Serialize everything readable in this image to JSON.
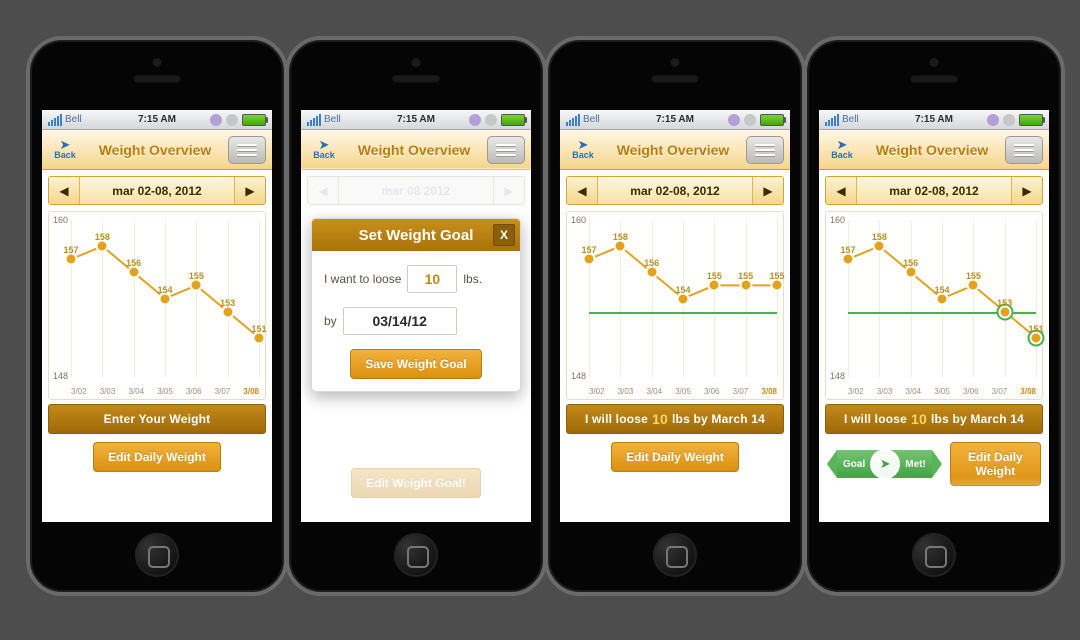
{
  "colors": {
    "accent": "#d38a0c",
    "green": "#4bb14b"
  },
  "status": {
    "carrier": "Bell",
    "time": "7:15 AM"
  },
  "nav": {
    "back_label": "Back",
    "title": "Weight Overview"
  },
  "date": {
    "range": "mar 02-08, 2012",
    "single": "mar 08 2012"
  },
  "chart_data": {
    "type": "line",
    "title": "",
    "xlabel": "",
    "ylabel": "",
    "ylim": [
      148,
      160
    ],
    "categories": [
      "3/02",
      "3/03",
      "3/04",
      "3/05",
      "3/06",
      "3/07",
      "3/08"
    ],
    "values": [
      157,
      158,
      156,
      154,
      155,
      153,
      151
    ],
    "values_alt": [
      157,
      158,
      156,
      154,
      155,
      155,
      155
    ],
    "goal_line": 153
  },
  "screen1": {
    "banner": "Enter Your Weight",
    "edit_btn": "Edit Daily Weight"
  },
  "modal": {
    "title": "Set Weight Goal",
    "lose_prefix": "I want to loose",
    "lose_value": "10",
    "lose_suffix": "lbs.",
    "by_label": "by",
    "date_value": "03/14/12",
    "save_btn": "Save Weight Goal",
    "bg_btn": "Edit Weight Goal!"
  },
  "goal_banner": {
    "pre": "I will loose",
    "amount": "10",
    "post": "lbs by March 14"
  },
  "edit_btn": "Edit Daily Weight",
  "ribbon": {
    "left": "Goal",
    "right": "Met!"
  }
}
